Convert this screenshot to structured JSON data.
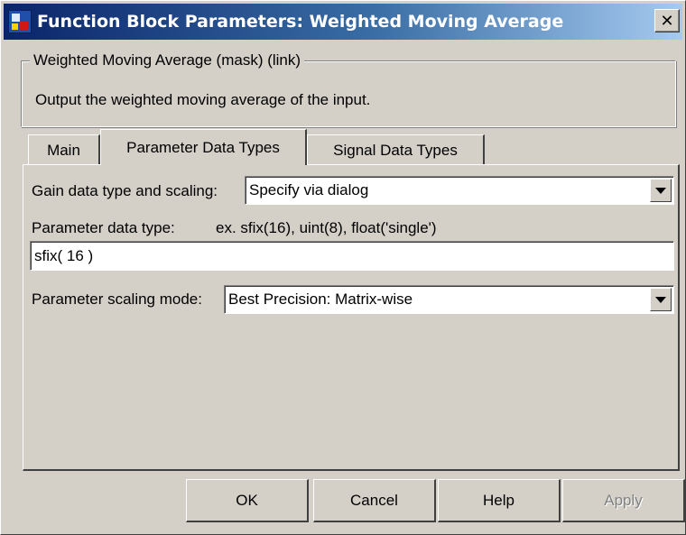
{
  "window": {
    "title": "Function Block Parameters: Weighted Moving Average",
    "close_label": "✕"
  },
  "description": {
    "group_label": "Weighted Moving Average (mask) (link)",
    "text": "Output the weighted moving average of the input."
  },
  "tabs": [
    {
      "label": "Main",
      "selected": false
    },
    {
      "label": "Parameter Data Types",
      "selected": true
    },
    {
      "label": "Signal Data Types",
      "selected": false
    }
  ],
  "parameters": {
    "gain_label": "Gain data type and scaling:",
    "gain_value": "Specify via dialog",
    "param_type_label": "Parameter data type:",
    "param_type_hint": "ex. sfix(16),  uint(8), float('single')",
    "param_type_value": "sfix( 16 )",
    "scaling_label": "Parameter scaling mode:",
    "scaling_value": "Best Precision: Matrix-wise"
  },
  "buttons": {
    "ok": "OK",
    "cancel": "Cancel",
    "help": "Help",
    "apply": "Apply"
  },
  "colors": {
    "titlebar_start": "#0a246a",
    "titlebar_end": "#a6caf0",
    "face": "#d4d0c8",
    "disabled_text": "#808080"
  }
}
